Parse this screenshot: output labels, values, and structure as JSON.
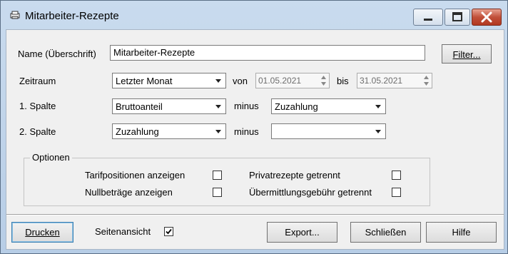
{
  "window": {
    "title": "Mitarbeiter-Rezepte"
  },
  "form": {
    "name_label": "Name (Überschrift)",
    "name_value": "Mitarbeiter-Rezepte",
    "filter_button": "Filter...",
    "zeitraum_label": "Zeitraum",
    "zeitraum_value": "Letzter Monat",
    "von_label": "von",
    "von_value": "01.05.2021",
    "bis_label": "bis",
    "bis_value": "31.05.2021",
    "spalte1_label": "1. Spalte",
    "spalte1_value": "Bruttoanteil",
    "minus1_label": "minus",
    "minus1_value": "Zuzahlung",
    "spalte2_label": "2. Spalte",
    "spalte2_value": "Zuzahlung",
    "minus2_label": "minus",
    "minus2_value": ""
  },
  "options": {
    "legend": "Optionen",
    "tarif_label": "Tarifpositionen anzeigen",
    "tarif_checked": false,
    "nullbetraege_label": "Nullbeträge anzeigen",
    "nullbetraege_checked": false,
    "privat_label": "Privatrezepte getrennt",
    "privat_checked": false,
    "uebermittlung_label": "Übermittlungsgebühr getrennt",
    "uebermittlung_checked": false
  },
  "footer": {
    "drucken_button": "Drucken",
    "seitenansicht_label": "Seitenansicht",
    "seitenansicht_checked": true,
    "export_button": "Export...",
    "schliessen_button": "Schließen",
    "hilfe_button": "Hilfe"
  },
  "icons": {
    "app": "printer-icon",
    "minimize": "minimize-icon",
    "maximize": "maximize-icon",
    "close": "close-icon",
    "dropdown": "chevron-down-icon",
    "spin": "spin-arrows-icon",
    "check": "checkmark-icon"
  },
  "colors": {
    "title_gradient_top": "#c9dbee",
    "client_bg": "#f0f0f0",
    "close_button": "#c1503a"
  }
}
